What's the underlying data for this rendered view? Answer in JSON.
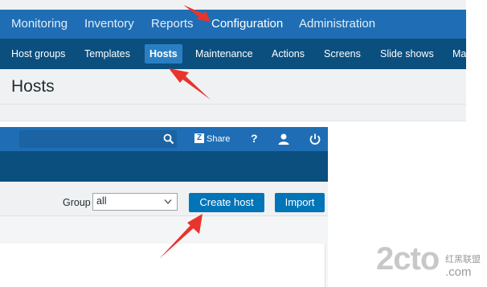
{
  "top_nav": {
    "items": [
      "Monitoring",
      "Inventory",
      "Reports",
      "Configuration",
      "Administration"
    ],
    "active": "Configuration"
  },
  "sub_nav": {
    "items": [
      "Host groups",
      "Templates",
      "Hosts",
      "Maintenance",
      "Actions",
      "Screens",
      "Slide shows",
      "Ma"
    ],
    "active": "Hosts"
  },
  "page": {
    "title": "Hosts"
  },
  "header_bar": {
    "search_icon": "search-icon",
    "share_logo": "Z",
    "share_label": "Share",
    "help_label": "?",
    "user_icon": "user-icon",
    "signout_icon": "power-icon"
  },
  "filter": {
    "group_label": "Group",
    "group_value": "all",
    "create_host_label": "Create host",
    "import_label": "Import"
  },
  "watermark": {
    "main": "2cto",
    "sub1": "红黑联盟",
    "sub2": ".com"
  },
  "colors": {
    "main_nav": "#1f6eb5",
    "sub_nav": "#0b4f7f",
    "active_tab": "#2a7fc4",
    "button": "#0275b8",
    "arrow": "#e8342b"
  }
}
